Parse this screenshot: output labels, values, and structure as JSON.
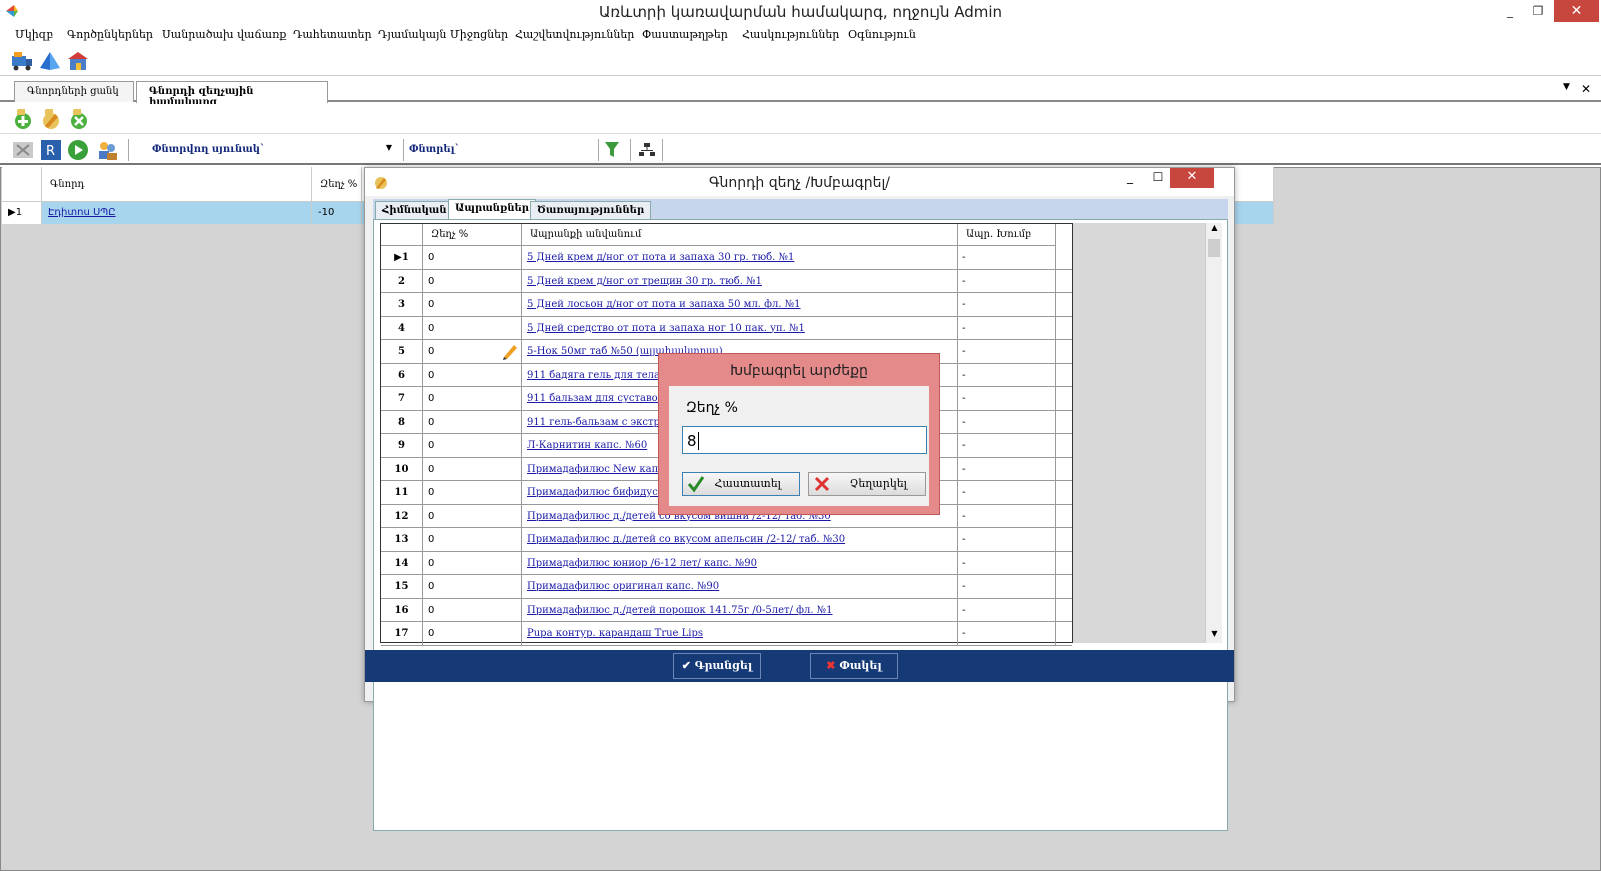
{
  "window": {
    "title": "Առևտրի կառավարման համակարգ, ողջույն Admin",
    "controls": [
      "_",
      "❐",
      "✕"
    ]
  },
  "menu": [
    "Մկիզբ",
    "Գործընկերներ",
    "Սանրածախ վաճառք",
    "Դահետատեր",
    "Դյամակայն Միջոցներ",
    "Հաշվետվություններ",
    "Փաստաթղթեր",
    "Հասկություններ",
    "Օգնություն"
  ],
  "doc_tabs": {
    "tab1": "Գնորդների ցանկ",
    "tab2": "Գնորդի զեղչային համակարգ"
  },
  "toolbar2": {
    "search_column_label": "Փնտրվող սյունակ`",
    "search_label": "Փնտրել`"
  },
  "list_grid": {
    "headers": [
      "Գնորդ",
      "Զեղչ %"
    ],
    "row": {
      "marker": "▶1",
      "name": "Էդիտոս ՍՊԸ",
      "discount": "-10"
    }
  },
  "modal": {
    "title": "Գնորդի զեղչ /Խմբագրել/",
    "tabs": [
      "Հիմնական",
      "Ապրանքներ",
      "Ծառայություններ"
    ],
    "grid_headers": [
      "Զեղչ %",
      "Ապրանքի անվանում",
      "Ապր. Խումբ"
    ],
    "rows": [
      {
        "num": "▶1",
        "disc": "0",
        "name": "5 Дней крем д/ног от пота и запаха 30 гр. тюб. №1",
        "code": "-"
      },
      {
        "num": "2",
        "disc": "0",
        "name": "5 Дней крем д/ног от трещин 30 гр. тюб. №1",
        "code": "-"
      },
      {
        "num": "3",
        "disc": "0",
        "name": "5 Дней лосьон д/ног от пота и запаха 50 мл. фл. №1",
        "code": "-"
      },
      {
        "num": "4",
        "disc": "0",
        "name": "5 Дней средство от пота и запаха ног 10 пак. уп. №1",
        "code": "-"
      },
      {
        "num": "5",
        "disc": "0",
        "name": "5-Нок 50мг таб №50 (ալյախակտոալ)",
        "code": "-"
      },
      {
        "num": "6",
        "disc": "0",
        "name": "911 бадяга гель для тела от",
        "code": "-"
      },
      {
        "num": "7",
        "disc": "0",
        "name": "911 бальзам для суставов с",
        "code": "-"
      },
      {
        "num": "8",
        "disc": "0",
        "name": "911 гель-бальзам с экстр. п",
        "code": "-"
      },
      {
        "num": "9",
        "disc": "0",
        "name": "Л-Карнитин капс. №60",
        "code": "-"
      },
      {
        "num": "10",
        "disc": "0",
        "name": "Примадафилюс New капс. №",
        "code": "-"
      },
      {
        "num": "11",
        "disc": "0",
        "name": "Примадафилюс бифидус (п",
        "code": "-"
      },
      {
        "num": "12",
        "disc": "0",
        "name": "Примадафилюс д./детей со вкусом вишни /2-12/ таб. №30",
        "code": "-"
      },
      {
        "num": "13",
        "disc": "0",
        "name": "Примадафилюс д./детей со вкусом апельсин /2-12/ таб. №30",
        "code": "-"
      },
      {
        "num": "14",
        "disc": "0",
        "name": "Примадафилюс юниор /6-12 лет/ капс. №90",
        "code": "-"
      },
      {
        "num": "15",
        "disc": "0",
        "name": "Примадафилюс оригинал капс. №90",
        "code": "-"
      },
      {
        "num": "16",
        "disc": "0",
        "name": "Примадафилюс д./детей порошок 141.75г /0-5лет/ фл. №1",
        "code": "-"
      },
      {
        "num": "17",
        "disc": "0",
        "name": "Pupa контур. карандаш True Lips",
        "code": "-"
      }
    ],
    "footer": {
      "save": "Գրանցել",
      "close": "Փակել"
    }
  },
  "edit_dialog": {
    "title": "Խմբագրել արժեքը",
    "label": "Զեղչ %",
    "value": "8",
    "ok": "Հաստատել",
    "cancel": "Չեղարկել"
  },
  "colors": {
    "footer_blue": "#153a76",
    "dialog_red": "#e58a8a",
    "selected_row": "#a8d5ee",
    "link": "#1a1aa6"
  }
}
